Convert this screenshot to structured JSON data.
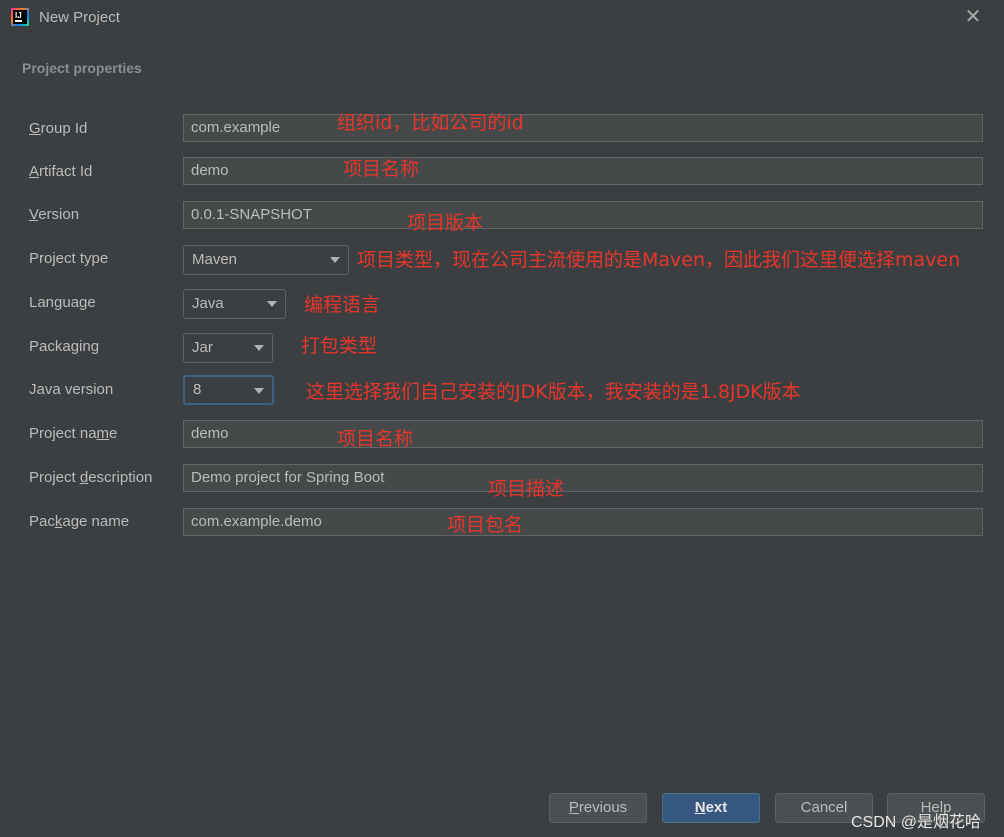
{
  "window": {
    "title": "New Project"
  },
  "section_title": "Project properties",
  "fields": {
    "group_id": {
      "label_pre": "",
      "label_key": "G",
      "label_post": "roup Id",
      "value": "com.example",
      "note": "组织id，比如公司的id"
    },
    "artifact_id": {
      "label_pre": "",
      "label_key": "A",
      "label_post": "rtifact Id",
      "value": "demo",
      "note": "项目名称"
    },
    "version": {
      "label_pre": "",
      "label_key": "V",
      "label_post": "ersion",
      "value": "0.0.1-SNAPSHOT",
      "note": "项目版本"
    },
    "project_type": {
      "label": "Project type",
      "value": "Maven",
      "note": "项目类型，现在公司主流使用的是Maven，因此我们这里便选择maven"
    },
    "language": {
      "label": "Language",
      "value": "Java",
      "note": "编程语言"
    },
    "packaging": {
      "label": "Packaging",
      "value": "Jar",
      "note": "打包类型"
    },
    "java_version": {
      "label": "Java version",
      "value": "8",
      "note": "这里选择我们自己安装的JDK版本，我安装的是1.8JDK版本"
    },
    "project_name": {
      "label_pre": "Project na",
      "label_key": "m",
      "label_post": "e",
      "value": "demo",
      "note": "项目名称"
    },
    "project_description": {
      "label_pre": "Project ",
      "label_key": "d",
      "label_post": "escription",
      "value": "Demo project for Spring Boot",
      "note": "项目描述"
    },
    "package_name": {
      "label_pre": "Pac",
      "label_key": "k",
      "label_post": "age name",
      "value": "com.example.demo",
      "note": "项目包名"
    }
  },
  "buttons": {
    "previous": {
      "key": "P",
      "rest": "revious"
    },
    "next": {
      "key": "N",
      "rest": "ext"
    },
    "cancel": "Cancel",
    "help": "Help"
  },
  "watermark": "CSDN @是烟花哈",
  "colors": {
    "background": "#3c3f41",
    "annotation": "#e8352b",
    "primary_button": "#365880"
  }
}
